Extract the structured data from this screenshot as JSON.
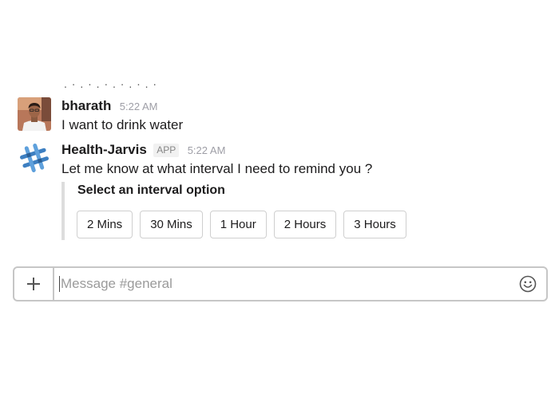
{
  "messages": [
    {
      "author": "bharath",
      "time": "5:22 AM",
      "text": "I want to drink water"
    },
    {
      "author": "Health-Jarvis",
      "badge": "APP",
      "time": "5:22 AM",
      "text": "Let me know at what interval I need to remind you ?",
      "attachment": {
        "title": "Select an interval option",
        "buttons": [
          "2 Mins",
          "30 Mins",
          "1 Hour",
          "2 Hours",
          "3 Hours"
        ]
      }
    }
  ],
  "composer": {
    "placeholder": "Message #general",
    "plus_icon": "plus-icon",
    "emoji_icon": "smiley-icon"
  },
  "colors": {
    "text": "#1d1c1d",
    "timestamp": "#9e9ea6",
    "border": "#c6c6c6",
    "attachment_bar": "#dddddd",
    "bot_avatar_blue": "#3d7fc1"
  }
}
